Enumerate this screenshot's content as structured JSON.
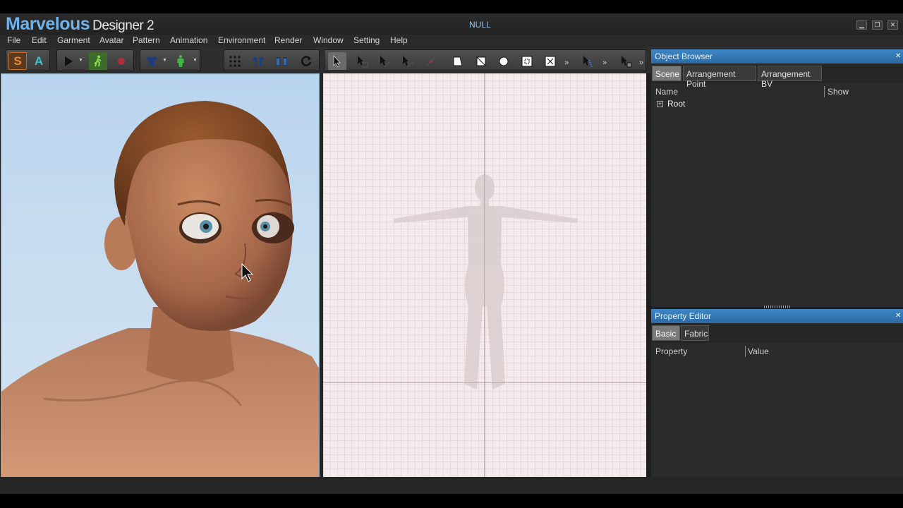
{
  "window": {
    "logo_main": "Marvelous",
    "logo_sub": "Designer 2",
    "document_title": "NULL"
  },
  "window_controls": {
    "minimize": "▁",
    "restore": "❐",
    "close": "✕"
  },
  "menu": [
    "File",
    "Edit",
    "Garment",
    "Avatar",
    "Pattern",
    "Animation",
    "Environment",
    "Render",
    "Window",
    "Setting",
    "Help"
  ],
  "toolbar": {
    "mode_simulation": "S",
    "mode_animation": "A",
    "overflow": "»"
  },
  "object_browser": {
    "title": "Object Browser",
    "close": "✕",
    "tabs": [
      "Scene",
      "Arrangement Point",
      "Arrangement BV"
    ],
    "active_tab": "Scene",
    "columns": [
      "Name",
      "Show"
    ],
    "tree": [
      {
        "expander": "+",
        "label": "Root"
      }
    ]
  },
  "property_editor": {
    "title": "Property Editor",
    "close": "✕",
    "tabs": [
      "Basic",
      "Fabric"
    ],
    "active_tab": "Basic",
    "columns": [
      "Property",
      "Value"
    ]
  },
  "colors": {
    "accent": "#3e87c6",
    "logo": "#6fb3ea",
    "panel_bg": "#2b2b2b",
    "pattern_bg": "#f4ecec"
  }
}
